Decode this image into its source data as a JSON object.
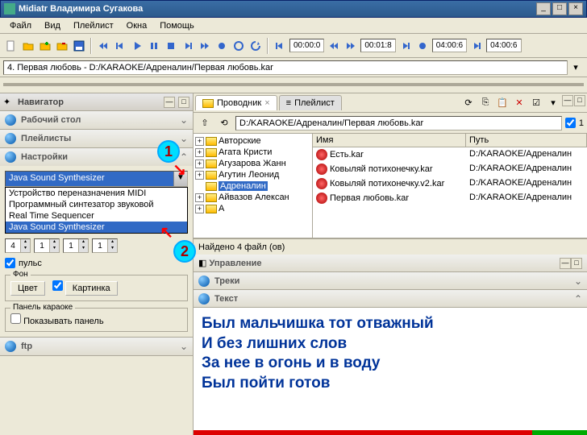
{
  "window": {
    "title": "Midiatr Владимира Сугакова"
  },
  "menu": {
    "file": "Файл",
    "view": "Вид",
    "playlist": "Плейлист",
    "windows": "Окна",
    "help": "Помощь"
  },
  "time": {
    "t1": "00:00:0",
    "t2": "00:01:8",
    "t3": "04:00:6",
    "t4": "04:00:6"
  },
  "track": {
    "current": "4. Первая любовь - D:/KARAOKE/Адреналин/Первая любовь.kar"
  },
  "nav": {
    "title": "Навигатор",
    "desktop": "Рабочий стол",
    "playlists": "Плейлисты",
    "settings": "Настройки",
    "ftp": "ftp"
  },
  "synth": {
    "selected": "Java Sound Synthesizer",
    "opt1": "Устройство переназначения MIDI",
    "opt2": "Программный синтезатор звуковой",
    "opt3": "Real Time Sequencer",
    "opt4": "Java Sound Synthesizer",
    "spin1": "4",
    "spin2": "1",
    "spin3": "1",
    "spin4": "1",
    "pulse": "пульс"
  },
  "bg": {
    "legend": "Фон",
    "color": "Цвет",
    "picture": "Картинка"
  },
  "karaoke": {
    "legend": "Панель караоке",
    "show": "Показывать панель"
  },
  "markers": {
    "m1": "1",
    "m2": "2"
  },
  "tabs": {
    "explorer": "Проводник",
    "playlist": "Плейлист"
  },
  "path": {
    "value": "D:/KARAOKE/Адреналин/Первая любовь.kar",
    "count": "1"
  },
  "tree": {
    "n1": "Авторские",
    "n2": "Агата Кристи",
    "n3": "Агузарова Жанн",
    "n4": "Агутин Леонид",
    "n5": "Адреналин",
    "n6": "Айвазов Алексан",
    "n7": "А"
  },
  "cols": {
    "name": "Имя",
    "path": "Путь"
  },
  "files": {
    "f1": {
      "name": "Есть.kar",
      "path": "D:/KARAOKE/Адреналин"
    },
    "f2": {
      "name": "Ковыляй потихонечку.kar",
      "path": "D:/KARAOKE/Адреналин"
    },
    "f3": {
      "name": "Ковыляй потихонечку.v2.kar",
      "path": "D:/KARAOKE/Адреналин"
    },
    "f4": {
      "name": "Первая любовь.kar",
      "path": "D:/KARAOKE/Адреналин"
    }
  },
  "status": {
    "text": "Найдено 4 файл (ов)"
  },
  "sections": {
    "control": "Управление",
    "tracks": "Треки",
    "text": "Текст"
  },
  "lyrics": {
    "l1": "Был мальчишка тот отважный",
    "l2": "И без лишних слов",
    "l3": "За нее в огонь и в воду",
    "l4": "Был пойти готов"
  }
}
